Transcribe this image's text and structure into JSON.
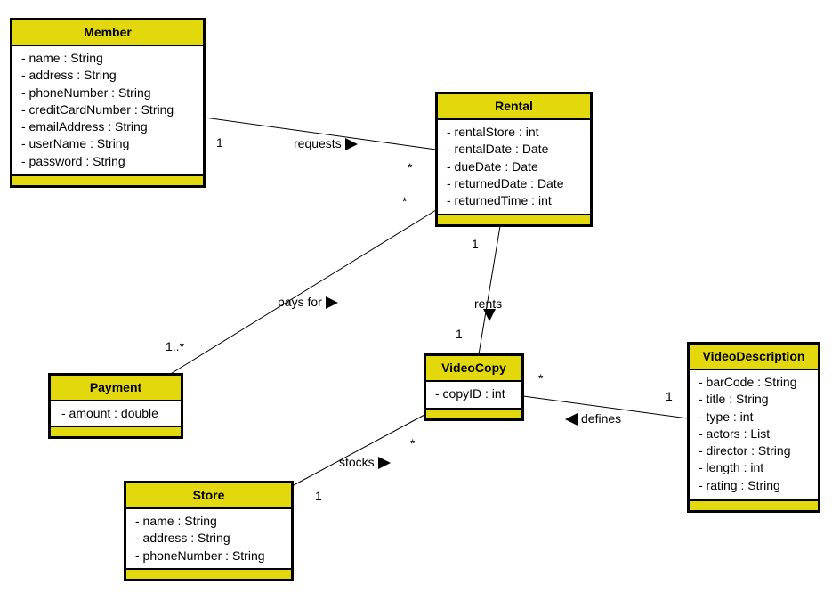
{
  "classes": {
    "member": {
      "name": "Member",
      "attributes": [
        "- name : String",
        "- address : String",
        "- phoneNumber : String",
        "- creditCardNumber : String",
        "- emailAddress : String",
        "- userName : String",
        "- password : String"
      ]
    },
    "rental": {
      "name": "Rental",
      "attributes": [
        "- rentalStore : int",
        "- rentalDate : Date",
        "- dueDate : Date",
        "- returnedDate : Date",
        "- returnedTime : int"
      ]
    },
    "payment": {
      "name": "Payment",
      "attributes": [
        "- amount : double"
      ]
    },
    "videocopy": {
      "name": "VideoCopy",
      "attributes": [
        "- copyID : int"
      ]
    },
    "videodescription": {
      "name": "VideoDescription",
      "attributes": [
        "- barCode : String",
        "- title : String",
        "- type : int",
        "- actors : List",
        "- director : String",
        "- length : int",
        "- rating : String"
      ]
    },
    "store": {
      "name": "Store",
      "attributes": [
        "- name : String",
        "- address : String",
        "- phoneNumber : String"
      ]
    }
  },
  "associations": {
    "requests": {
      "label": "requests",
      "direction": "right",
      "from": "Member",
      "to": "Rental",
      "from_mult": "1",
      "to_mult": "*"
    },
    "pays_for": {
      "label": "pays for",
      "direction": "right",
      "from": "Payment",
      "to": "Rental",
      "from_mult": "1..*",
      "to_mult": "*"
    },
    "rents": {
      "label": "rents",
      "direction": "down",
      "from": "Rental",
      "to": "VideoCopy",
      "from_mult": "1",
      "to_mult": "1"
    },
    "defines": {
      "label": "defines",
      "direction": "left",
      "from": "VideoDescription",
      "to": "VideoCopy",
      "from_mult": "1",
      "to_mult": "*"
    },
    "stocks": {
      "label": "stocks",
      "direction": "right",
      "from": "Store",
      "to": "VideoCopy",
      "from_mult": "1",
      "to_mult": "*"
    }
  }
}
